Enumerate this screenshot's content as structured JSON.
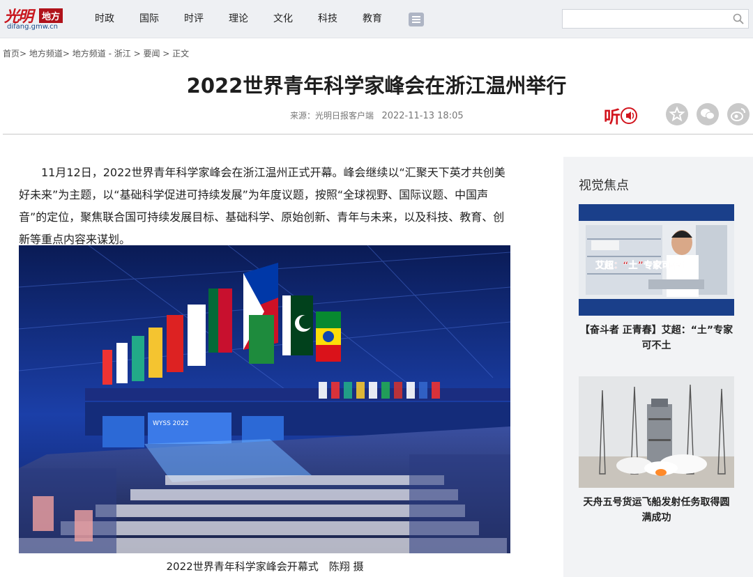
{
  "site": {
    "logo_text": "光明",
    "logo_badge": "地方",
    "logo_url": "difang.gmw.cn"
  },
  "nav": {
    "items": [
      "时政",
      "国际",
      "时评",
      "理论",
      "文化",
      "科技",
      "教育"
    ]
  },
  "search": {
    "value": "",
    "placeholder": ""
  },
  "breadcrumb": {
    "home": "首页",
    "level1": "地方频道",
    "level2": "地方频道 - 浙江",
    "level3": "要闻",
    "current": "正文"
  },
  "article": {
    "title": "2022世界青年科学家峰会在浙江温州举行",
    "source": "来源：光明日报客户端",
    "date": "2022-11-13 18:05",
    "listen_label": "听",
    "body": "11月12日，2022世界青年科学家峰会在浙江温州正式开幕。峰会继续以“汇聚天下英才共创美好未来”为主题，以“基础科学促进可持续发展”为年度议题，按照“全球视野、国际议题、中国声音”的定位，聚焦联合国可持续发展目标、基础科学、原始创新、青年与未来，以及科技、教育、创新等重点内容来谋划。",
    "photo_caption": "2022世界青年科学家峰会开幕式　陈翔 摄",
    "photo_screen_text": "WYSS 2022"
  },
  "sidebar": {
    "title": "视觉焦点",
    "items": [
      {
        "caption": "【奋斗者 正青春】艾超：“土”专家可不土",
        "overlay": "艾超：“土”专家可不土"
      },
      {
        "caption": "天舟五号货运飞船发射任务取得圆满成功"
      }
    ]
  },
  "colors": {
    "brand_red": "#c8151d",
    "topbar_bg": "#eef0f3",
    "sidebar_bg": "#f2f3f5"
  }
}
